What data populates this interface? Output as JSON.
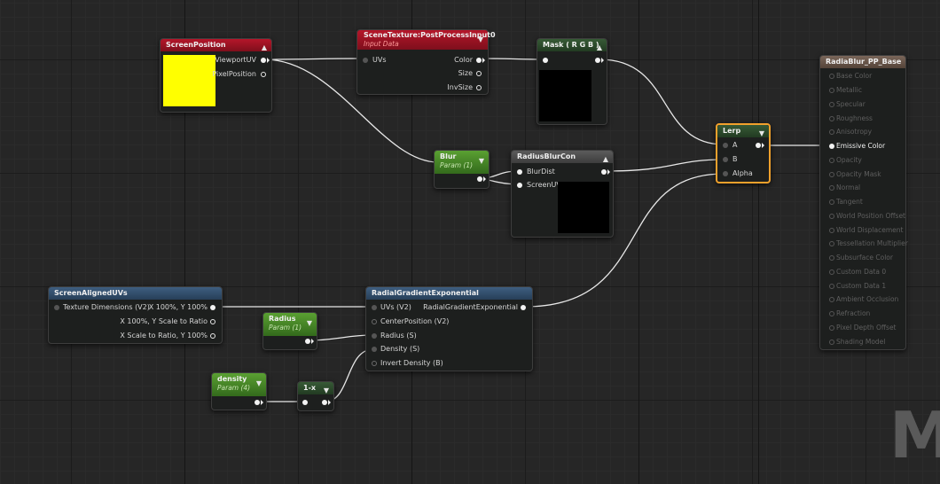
{
  "nodes": {
    "screen_position": {
      "title": "ScreenPosition",
      "outputs": [
        "ViewportUV",
        "PixelPosition"
      ],
      "preview_color": "#ffff00"
    },
    "scene_texture": {
      "title": "SceneTexture:PostProcessInput0",
      "subtitle": "Input Data",
      "inputs": [
        "UVs"
      ],
      "outputs": [
        "Color",
        "Size",
        "InvSize"
      ]
    },
    "mask": {
      "title": "Mask ( R G B )"
    },
    "blur": {
      "title": "Blur",
      "subtitle": "Param (1)"
    },
    "radius_blur_con": {
      "title": "RadiusBlurCon",
      "inputs": [
        "BlurDist",
        "ScreenUV"
      ]
    },
    "lerp": {
      "title": "Lerp",
      "inputs": [
        "A",
        "B",
        "Alpha"
      ],
      "border_color": "#f2a12c"
    },
    "screen_aligned_uvs": {
      "title": "ScreenAlignedUVs",
      "input": "Texture Dimensions (V2)",
      "outputs": [
        "X 100%, Y 100%",
        "X 100%, Y Scale to Ratio",
        "X Scale to Ratio, Y 100%"
      ]
    },
    "radius": {
      "title": "Radius",
      "subtitle": "Param (1)"
    },
    "radial_gradient": {
      "title": "RadialGradientExponential",
      "inputs": [
        "UVs (V2)",
        "CenterPosition (V2)",
        "Radius (S)",
        "Density (S)",
        "Invert Density (B)"
      ],
      "output": "RadialGradientExponential"
    },
    "density": {
      "title": "density",
      "subtitle": "Param (4)"
    },
    "one_minus": {
      "title": "1-x"
    },
    "result": {
      "title": "RadiaBlur_PP_Base",
      "pins": [
        "Base Color",
        "Metallic",
        "Specular",
        "Roughness",
        "Anisotropy",
        "Emissive Color",
        "Opacity",
        "Opacity Mask",
        "Normal",
        "Tangent",
        "World Position Offset",
        "World Displacement",
        "Tessellation Multiplier",
        "Subsurface Color",
        "Custom Data 0",
        "Custom Data 1",
        "Ambient Occlusion",
        "Refraction",
        "Pixel Depth Offset",
        "Shading Model"
      ],
      "active_pin": "Emissive Color"
    }
  },
  "icons": {
    "collapse_up": "▲",
    "collapse_down": "▼"
  },
  "watermark": "M",
  "colors": {
    "wire": "#e8e8e8",
    "lerp_selected": "#f2a12c",
    "param_green": "#5aa032"
  }
}
